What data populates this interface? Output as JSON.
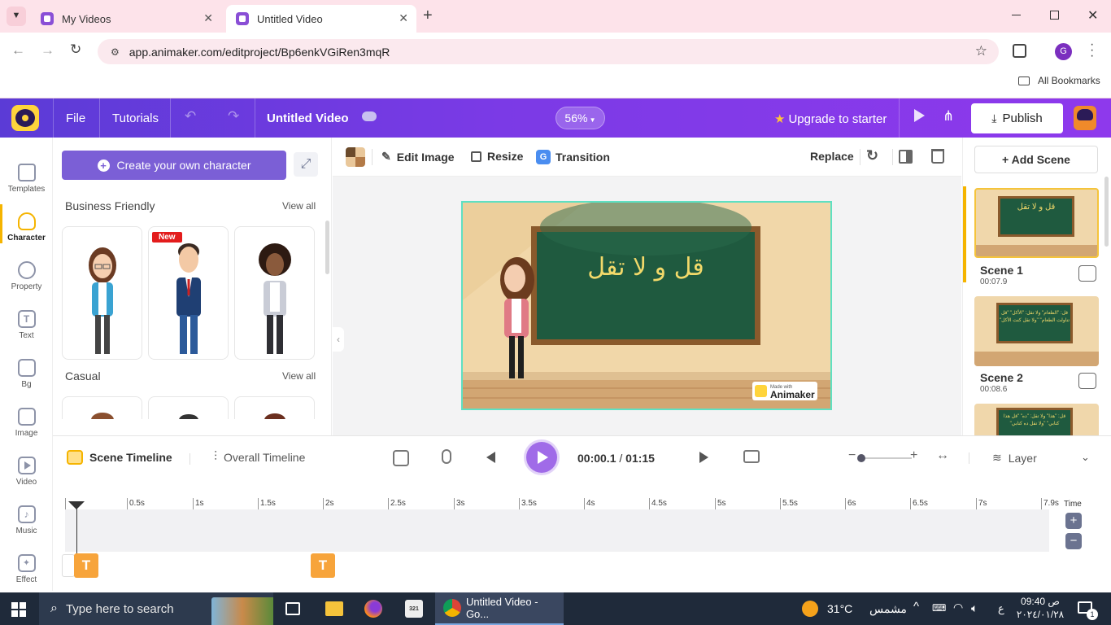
{
  "browser": {
    "tabs": [
      {
        "title": "My Videos"
      },
      {
        "title": "Untitled Video"
      }
    ],
    "url": "app.animaker.com/editproject/Bp6enkVGiRen3mqR",
    "bookmarks_label": "All Bookmarks",
    "profile_initial": "G"
  },
  "header": {
    "file": "File",
    "tutorials": "Tutorials",
    "project_title": "Untitled Video",
    "zoom": "56%",
    "upgrade": "Upgrade to starter",
    "publish": "Publish"
  },
  "rail": {
    "items": [
      {
        "label": "Templates"
      },
      {
        "label": "Character"
      },
      {
        "label": "Property"
      },
      {
        "label": "Text"
      },
      {
        "label": "Bg"
      },
      {
        "label": "Image"
      },
      {
        "label": "Video"
      },
      {
        "label": "Music"
      },
      {
        "label": "Effect"
      }
    ],
    "active_color": "#f5b400"
  },
  "characters": {
    "create_button": "Create your own character",
    "sections": [
      {
        "title": "Business Friendly",
        "view_all": "View all"
      },
      {
        "title": "Casual",
        "view_all": "View all"
      }
    ],
    "new_badge": "New"
  },
  "toolbar": {
    "edit_image": "Edit Image",
    "resize": "Resize",
    "transition": "Transition",
    "replace": "Replace"
  },
  "canvas": {
    "board_text": "قل و لا تقل",
    "watermark_small": "Made with",
    "watermark": "Animaker"
  },
  "scenes": {
    "add_scene": "+ Add Scene",
    "list": [
      {
        "name": "Scene 1",
        "duration": "00:07.9",
        "thumb_text": "قل و لا تقل"
      },
      {
        "name": "Scene 2",
        "duration": "00:08.6",
        "thumb_text": "قل: \"الطعام\" ولا تقل: \"الأكل\" \"قل تناولت الطعام\" \"ولا تقل كنت الأكل\""
      },
      {
        "thumb_text": "قل: \"هذا\" ولا تقل: \"ده\" \"قل هذا كتابي\" \"ولا تقل ده كتابي\""
      }
    ]
  },
  "timeline": {
    "scene_tab": "Scene Timeline",
    "overall_tab": "Overall Timeline",
    "current_time": "00:00.1",
    "separator": "/",
    "total_time": "01:15",
    "layer": "Layer",
    "time_label": "Time",
    "ticks": [
      "0.5s",
      "1s",
      "1.5s",
      "2s",
      "2.5s",
      "3s",
      "3.5s",
      "4s",
      "4.5s",
      "5s",
      "5.5s",
      "6s",
      "6.5s",
      "7s",
      "7.9s"
    ],
    "clip_label": "T"
  },
  "taskbar": {
    "search_placeholder": "Type here to search",
    "chrome_window": "Untitled Video - Go...",
    "temperature": "31°C",
    "weather": "مشمس",
    "lang": "ع",
    "time": "09:40 ص",
    "date": "٢٠٢٤/٠١/٢٨",
    "notification_count": "1"
  }
}
